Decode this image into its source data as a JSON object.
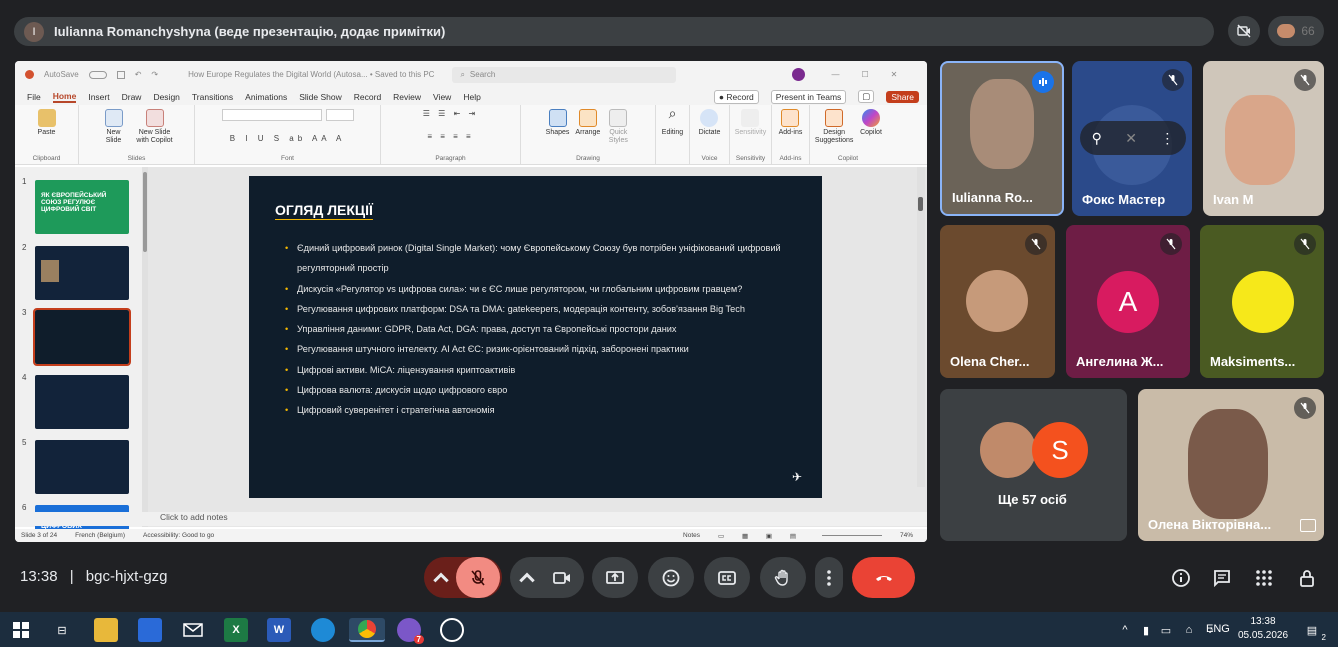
{
  "presenter": {
    "initial": "I",
    "text": "Iulianna Romanchyshyna (веде презентацію, додає примітки)"
  },
  "top_right": {
    "participants_count": "66"
  },
  "ppt": {
    "autosave": "AutoSave",
    "file_title": "How Europe Regulates the Digital World (Autosa... • Saved to this PC",
    "search": "Search",
    "menu": [
      "File",
      "Home",
      "Insert",
      "Draw",
      "Design",
      "Transitions",
      "Animations",
      "Slide Show",
      "Record",
      "Review",
      "View",
      "Help"
    ],
    "record": "Record",
    "present_teams": "Present in Teams",
    "share": "Share",
    "ribbon": {
      "paste": "Paste",
      "clipboard": "Clipboard",
      "new_slide": "New Slide",
      "new_slide_copilot": "New Slide with Copilot",
      "slides": "Slides",
      "font": "Font",
      "paragraph": "Paragraph",
      "shapes": "Shapes",
      "arrange": "Arrange",
      "quick_styles": "Quick Styles",
      "drawing": "Drawing",
      "editing": "Editing",
      "dictate": "Dictate",
      "voice": "Voice",
      "sensitivity": "Sensitivity",
      "add_ins": "Add-ins",
      "design_suggestions": "Design Suggestions",
      "copilot": "Copilot"
    },
    "thumbs": [
      {
        "n": "1",
        "text": "ЯК ЄВРОПЕЙСЬКИЙ СОЮЗ РЕГУЛЮЄ ЦИФРОВИЙ СВІТ"
      },
      {
        "n": "2",
        "text": ""
      },
      {
        "n": "3",
        "text": ""
      },
      {
        "n": "4",
        "text": ""
      },
      {
        "n": "5",
        "text": ""
      },
      {
        "n": "6",
        "text": "РЕГУЛЮВАННЯ ЦИФРОВИХ"
      }
    ],
    "slide": {
      "title": "ОГЛЯД ЛЕКЦІЇ",
      "bullets": [
        "Єдиний цифровий ринок (Digital Single Market): чому Європейському Союзу був потрібен уніфікований цифровий регуляторний простір",
        "Дискусія «Регулятор vs цифрова сила»: чи є ЄС лише регулятором, чи глобальним цифровим гравцем?",
        "Регулювання цифрових платформ: DSA та DMA: gatekeepers, модерація контенту, зобов'язання Big Tech",
        "Управління даними: GDPR, Data Act, DGA: права, доступ та Європейські простори даних",
        "Регулювання штучного інтелекту. AI Act ЄС: ризик-орієнтований підхід, заборонені практики",
        "Цифрові активи. MiCA: ліцензування криптоактивів",
        "Цифрова валюта: дискусія щодо цифрового євро",
        "Цифровий суверенітет і стратегічна автономія"
      ]
    },
    "notes": "Click to add notes",
    "status": {
      "slide": "Slide 3 of 24",
      "language": "French (Belgium)",
      "accessibility": "Accessibility: Good to go",
      "notes_btn": "Notes",
      "zoom": "74%"
    }
  },
  "tiles": [
    {
      "name": "Iulianna Ro..."
    },
    {
      "name": "Фокс Мастер"
    },
    {
      "name": "Ivan M"
    },
    {
      "name": "Olena Cher..."
    },
    {
      "name": "Ангелина Ж...",
      "initial": "A"
    },
    {
      "name": "Maksiments..."
    },
    {
      "name": "Ще 57 осіб",
      "initial": "S"
    },
    {
      "name": "Олена Вікторівна..."
    }
  ],
  "meeting": {
    "time": "13:38",
    "separator": "|",
    "code": "bgc-hjxt-gzg"
  },
  "taskbar": {
    "lang": "ENG",
    "time": "13:38",
    "date": "05.05.2026",
    "notif": "2",
    "viber_badge": "7"
  },
  "colors": {
    "accent_red": "#ea4335",
    "presenter_border": "#8ab4f8",
    "slide_bg": "#0f1d2b",
    "bullet": "#f5b800"
  }
}
